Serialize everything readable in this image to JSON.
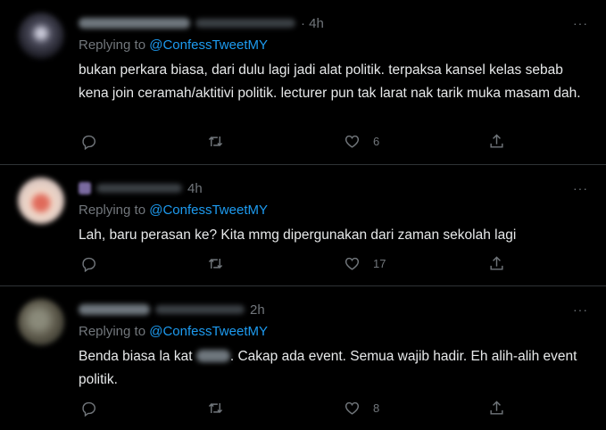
{
  "tweets": [
    {
      "time": "· 4h",
      "replying_prefix": "Replying to ",
      "replying_to": "@ConfessTweetMY",
      "text": "bukan perkara biasa, dari dulu lagi jadi alat politik. terpaksa kansel kelas sebab kena join ceramah/aktitivi politik. lecturer pun tak larat nak tarik muka masam dah.",
      "likes": "6",
      "more": "···"
    },
    {
      "time": "4h",
      "replying_prefix": "Replying to ",
      "replying_to": "@ConfessTweetMY",
      "text": "Lah, baru perasan ke? Kita mmg dipergunakan dari zaman sekolah lagi",
      "likes": "17",
      "more": "···"
    },
    {
      "time": "2h",
      "replying_prefix": "Replying to ",
      "replying_to": "@ConfessTweetMY",
      "text_before": "Benda biasa la kat ",
      "text_after": ". Cakap ada event. Semua wajib hadir. Eh alih-alih event politik.",
      "likes": "8",
      "more": "···"
    }
  ],
  "icons": {
    "reply": "reply-icon",
    "retweet": "retweet-icon",
    "like": "heart-icon",
    "share": "share-icon",
    "more": "more-icon"
  },
  "colors": {
    "background": "#000000",
    "text": "#e7e9ea",
    "muted": "#71767b",
    "accent": "#1d9bf0",
    "divider": "#2f3336"
  }
}
